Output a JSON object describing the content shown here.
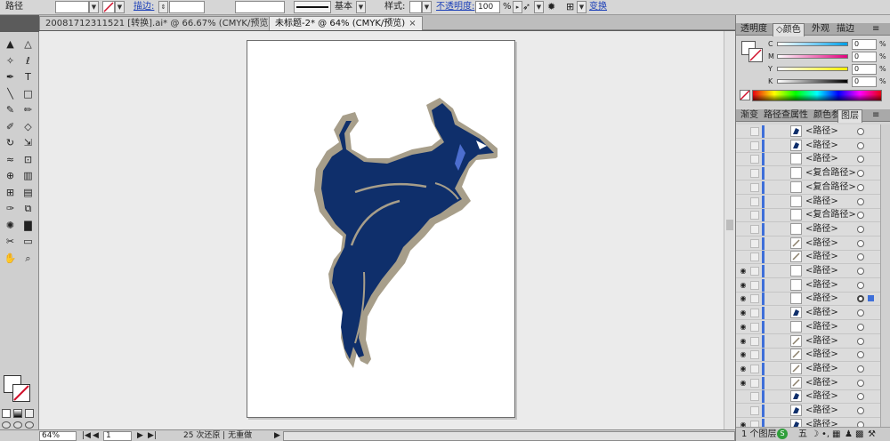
{
  "control_bar": {
    "selection_label": "路径",
    "stroke_label": "描边:",
    "brush_label": "基本",
    "style_label": "样式:",
    "opacity_label": "不透明度:",
    "opacity_value": "100",
    "opacity_unit": "%",
    "transform_label": "变换"
  },
  "tabs": [
    {
      "label": "20081712311521 [转换].ai* @ 66.67% (CMYK/预览)",
      "active": false
    },
    {
      "label": "未标题-2* @ 64% (CMYK/预览)",
      "active": true
    }
  ],
  "tab_close": "×",
  "colors": {
    "kangaroo_fill": "#0f2f6b",
    "kangaroo_outline": "#a79e8a",
    "canvas_bg": "#ebebeb",
    "panel_bg": "#d4d4d4",
    "layer_color": "#3e6fd9"
  },
  "tools": [
    "selection-tool",
    "direct-selection-tool",
    "magic-wand-tool",
    "lasso-tool",
    "pen-tool",
    "type-tool",
    "line-tool",
    "rectangle-tool",
    "paintbrush-tool",
    "pencil-tool",
    "blob-brush-tool",
    "eraser-tool",
    "rotate-tool",
    "scale-tool",
    "warp-tool",
    "free-transform-tool",
    "shape-builder-tool",
    "perspective-grid-tool",
    "mesh-tool",
    "gradient-tool",
    "eyedropper-tool",
    "blend-tool",
    "symbol-sprayer-tool",
    "column-graph-tool",
    "slice-tool",
    "artboard-tool",
    "hand-tool",
    "zoom-tool"
  ],
  "tool_glyphs": {
    "type-tool": "T"
  },
  "status_bar": {
    "zoom": "64%",
    "page": "1",
    "history": "25 次还原 | 无重做"
  },
  "color_panel": {
    "tabs": [
      "透明度",
      "颜色",
      "外观",
      "描边"
    ],
    "channels": [
      {
        "label": "C",
        "value": "0",
        "unit": "%"
      },
      {
        "label": "M",
        "value": "0",
        "unit": "%"
      },
      {
        "label": "Y",
        "value": "0",
        "unit": "%"
      },
      {
        "label": "K",
        "value": "0",
        "unit": "%"
      }
    ]
  },
  "layers_panel": {
    "tabs": [
      "渐变",
      "路径查",
      "属性",
      "颜色参",
      "图层"
    ],
    "rows": [
      {
        "name": "<路径>",
        "visible": false,
        "thumb": "path"
      },
      {
        "name": "<路径>",
        "visible": false,
        "thumb": "path"
      },
      {
        "name": "<路径>",
        "visible": false,
        "thumb": "blank"
      },
      {
        "name": "<复合路径>",
        "visible": false,
        "thumb": "blank"
      },
      {
        "name": "<复合路径>",
        "visible": false,
        "thumb": "blank"
      },
      {
        "name": "<路径>",
        "visible": false,
        "thumb": "blank"
      },
      {
        "name": "<复合路径>",
        "visible": false,
        "thumb": "blank"
      },
      {
        "name": "<路径>",
        "visible": false,
        "thumb": "blank"
      },
      {
        "name": "<路径>",
        "visible": false,
        "thumb": "line"
      },
      {
        "name": "<路径>",
        "visible": false,
        "thumb": "line"
      },
      {
        "name": "<路径>",
        "visible": true,
        "thumb": "blank"
      },
      {
        "name": "<路径>",
        "visible": true,
        "thumb": "blank"
      },
      {
        "name": "<路径>",
        "visible": true,
        "thumb": "blank",
        "selected": true
      },
      {
        "name": "<路径>",
        "visible": true,
        "thumb": "path"
      },
      {
        "name": "<路径>",
        "visible": true,
        "thumb": "blank"
      },
      {
        "name": "<路径>",
        "visible": true,
        "thumb": "line"
      },
      {
        "name": "<路径>",
        "visible": true,
        "thumb": "line"
      },
      {
        "name": "<路径>",
        "visible": true,
        "thumb": "line"
      },
      {
        "name": "<路径>",
        "visible": true,
        "thumb": "line"
      },
      {
        "name": "<路径>",
        "visible": false,
        "thumb": "path"
      },
      {
        "name": "<路径>",
        "visible": false,
        "thumb": "path"
      },
      {
        "name": "<路径>",
        "visible": true,
        "thumb": "path"
      },
      {
        "name": "<路径>",
        "visible": true,
        "thumb": "path"
      },
      {
        "name": "<路径>",
        "visible": true,
        "thumb": "line"
      }
    ],
    "footer": "1 个图层"
  }
}
